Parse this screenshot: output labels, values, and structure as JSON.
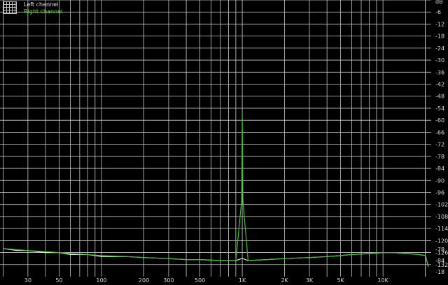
{
  "legend": {
    "left_label": "Left channel",
    "right_label": "Right channel"
  },
  "colors": {
    "background": "#000000",
    "grid": "#c8c8c8",
    "tick_text": "#d8d8d8",
    "left_channel": "#e6e6e6",
    "right_channel": "#3fbf2f"
  },
  "chart_data": {
    "type": "line",
    "title": "",
    "xlabel": "",
    "ylabel": "",
    "y_unit_label": "dB",
    "x_scale": "log",
    "xlim": [
      19,
      22000
    ],
    "ylim": [
      -138,
      0
    ],
    "grid": true,
    "legend_position": "top-left",
    "x_tick_labels": [
      "30",
      "50",
      "100",
      "200",
      "300",
      "500",
      "1K",
      "2K",
      "3K",
      "5K",
      "10K"
    ],
    "x_tick_values": [
      30,
      50,
      100,
      200,
      300,
      500,
      1000,
      2000,
      3000,
      5000,
      10000
    ],
    "y_tick_labels": [
      "dB",
      "-6",
      "-12",
      "-18",
      "-24",
      "-30",
      "-36",
      "-42",
      "-48",
      "-54",
      "-60",
      "-66",
      "-72",
      "-78",
      "-84",
      "-90",
      "-96",
      "-102",
      "-108",
      "-114",
      "-120",
      "-126",
      "-132",
      "-78",
      "-84",
      "-18"
    ],
    "y_tick_values": [
      0,
      -6,
      -12,
      -18,
      -24,
      -30,
      -36,
      -42,
      -48,
      -54,
      -60,
      -66,
      -72,
      -78,
      -84,
      -90,
      -96,
      -102,
      -108,
      -114,
      -120,
      -126,
      -132
    ],
    "series": [
      {
        "name": "Left channel",
        "x": [
          20,
          25,
          30,
          40,
          50,
          60,
          80,
          100,
          150,
          200,
          300,
          400,
          500,
          700,
          900,
          990,
          1000,
          1010,
          1100,
          1500,
          2000,
          3000,
          4000,
          5000,
          6000,
          8000,
          10000,
          12000,
          15000,
          18000,
          20000,
          21000
        ],
        "values": [
          -124,
          -125,
          -125,
          -126,
          -126,
          -127,
          -127,
          -128,
          -128,
          -128.5,
          -129,
          -129.5,
          -129.5,
          -130,
          -130,
          -129,
          -129,
          -129,
          -130,
          -129.5,
          -129,
          -128.5,
          -128,
          -127.5,
          -127,
          -126.5,
          -126,
          -126,
          -126.5,
          -127,
          -127.5,
          -133
        ]
      },
      {
        "name": "Right channel",
        "x": [
          20,
          25,
          30,
          40,
          50,
          60,
          80,
          100,
          150,
          200,
          300,
          400,
          500,
          700,
          900,
          990,
          1000,
          1010,
          1100,
          1500,
          2000,
          3000,
          4000,
          5000,
          6000,
          8000,
          10000,
          12000,
          15000,
          18000,
          20000,
          21000
        ],
        "values": [
          -124,
          -124.5,
          -125,
          -125.5,
          -126,
          -126.5,
          -127,
          -127.5,
          -128,
          -128.5,
          -129,
          -129.5,
          -129.5,
          -130,
          -130,
          -100,
          -58,
          -100,
          -130,
          -129.5,
          -129,
          -128.5,
          -128,
          -127.5,
          -127,
          -126.5,
          -126,
          -126,
          -126.5,
          -127,
          -127.5,
          -133
        ]
      }
    ]
  }
}
